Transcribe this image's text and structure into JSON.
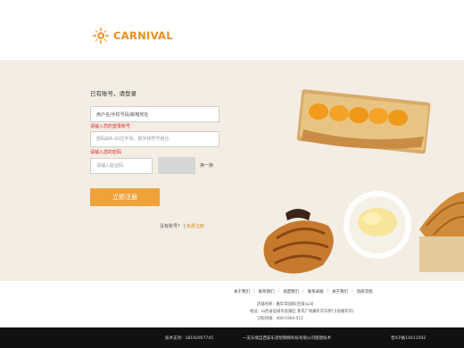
{
  "brand": {
    "name": "CARNIVAL",
    "accent": "#e88f1e"
  },
  "login_form": {
    "title": "已有账号，请登录",
    "account_input": {
      "value": "用户名/手机号码/邮箱地址"
    },
    "account_error": "请输入您的登录账号",
    "password_input": {
      "placeholder": "密码由6-20位字母、数字和符号组合"
    },
    "password_error": "请输入您的密码",
    "captcha_input": {
      "placeholder": "请输入验证码"
    },
    "captcha_refresh_label": "换一换",
    "submit_label": "立即注册",
    "login_prompt": "没有账号？",
    "login_separator": "|",
    "login_link_label": "免费注册"
  },
  "footer": {
    "links": [
      "关于我们",
      "联系我们",
      "加盟我们",
      "联系采服",
      "关于我们",
      "资质流程"
    ],
    "info_lines": [
      "店铺名称：嘉年华国际(连锁)公司",
      "地址：山西省运城市盐湖区 莱氏广场嘉年华东侧门(居嘉年华)",
      "订购热线：400-0364-511"
    ]
  },
  "bottom_bar": {
    "tech_support": "技术支持：18192957745",
    "copyright": "一支乐境自西安乐诺智网络科技有限公司搭建技术",
    "icp": "晋ICP备14011592"
  },
  "colors": {
    "page_bg": "#f3ede4",
    "button": "#f0a23a",
    "error": "#d8282c",
    "bottom_bar": "#111111"
  }
}
